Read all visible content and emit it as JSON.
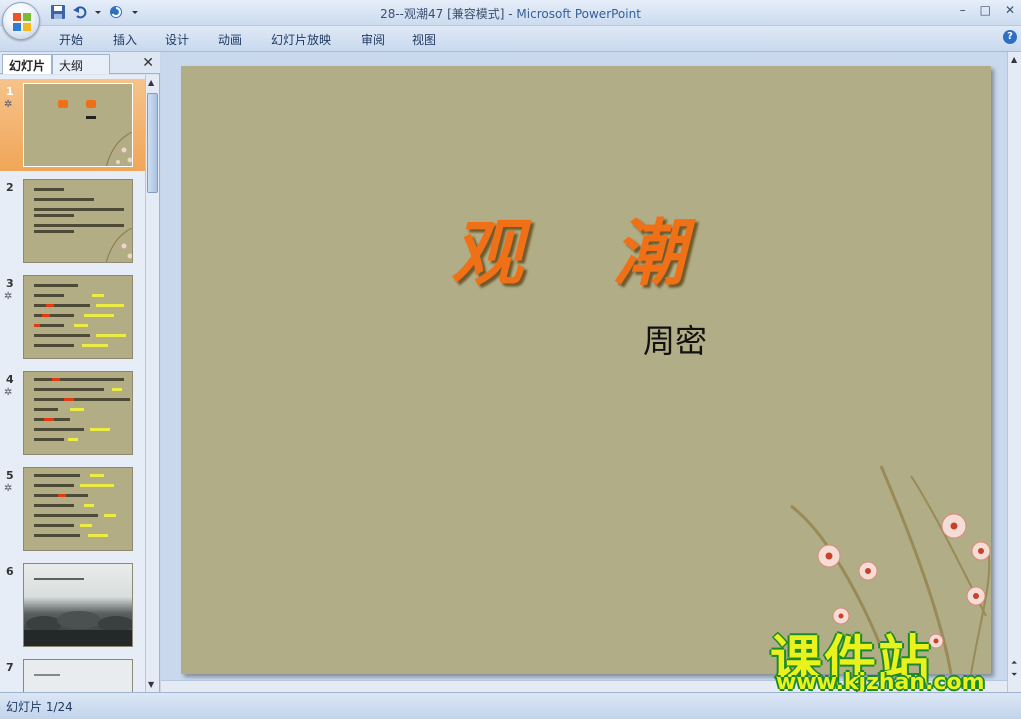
{
  "window": {
    "title": "28--观潮47 [兼容模式] - ",
    "app_name": "Microsoft PowerPoint",
    "controls": [
      "–",
      "□",
      "✕"
    ]
  },
  "ribbon": {
    "tabs": [
      "开始",
      "插入",
      "设计",
      "动画",
      "幻灯片放映",
      "审阅",
      "视图"
    ]
  },
  "panel": {
    "tabs": [
      "幻灯片",
      "大纲"
    ],
    "thumbnails": [
      {
        "num": "1",
        "selected": true
      },
      {
        "num": "2"
      },
      {
        "num": "3"
      },
      {
        "num": "4"
      },
      {
        "num": "5"
      },
      {
        "num": "6"
      },
      {
        "num": "7"
      }
    ]
  },
  "slide": {
    "title": "观潮",
    "author": "周密"
  },
  "watermark": {
    "text": "课件站",
    "url": "www.kjzhan.com"
  },
  "statusbar": {
    "slide_counter": "幻灯片 1/24"
  },
  "colors": {
    "slide_bg": "#b1ad86",
    "title_orange": "#f07018",
    "selected_thumb": "#f0a658"
  }
}
